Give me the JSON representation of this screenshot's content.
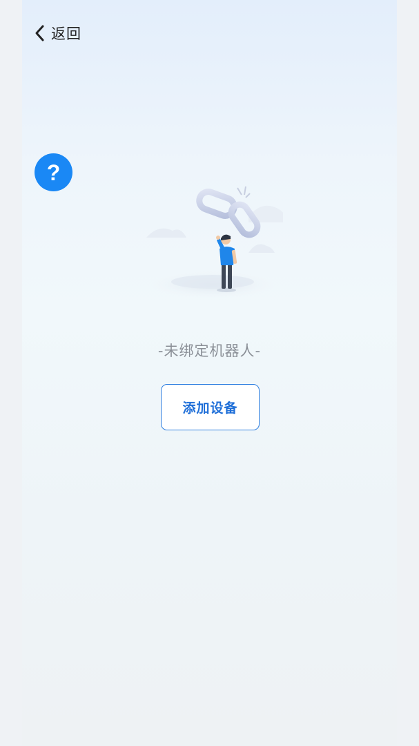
{
  "nav": {
    "back_label": "返回",
    "back_icon": "chevron-left-icon"
  },
  "help": {
    "glyph": "?",
    "icon": "help-icon",
    "color": "#1a88f5"
  },
  "empty_state": {
    "illustration": "broken-link-illustration",
    "status_text": "-未绑定机器人-"
  },
  "actions": {
    "add_device_label": "添加设备",
    "accent_color": "#2f7fe0"
  }
}
